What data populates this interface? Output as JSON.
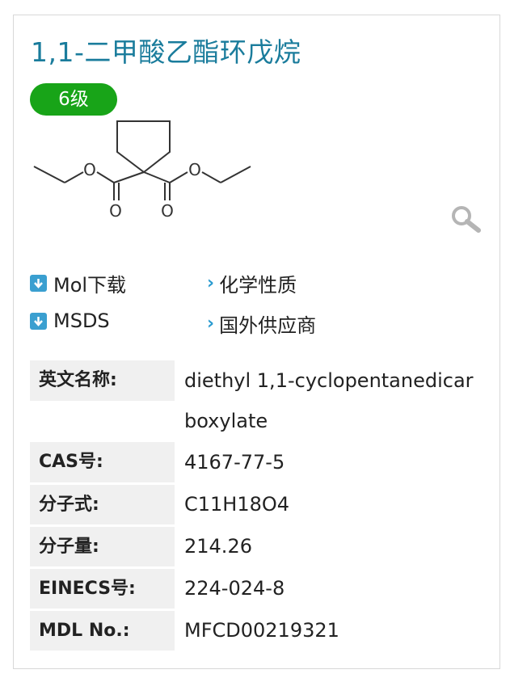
{
  "title": "1,1-二甲酸乙酯环戊烷",
  "badge": "6级",
  "structure": {
    "atom_labels": [
      "O",
      "O",
      "O",
      "O"
    ],
    "zoom_icon": "magnifier-icon"
  },
  "links": {
    "mol_download": "Mol下载",
    "msds": "MSDS",
    "chemical_properties": "化学性质",
    "foreign_suppliers": "国外供应商"
  },
  "properties": [
    {
      "label": "英文名称:",
      "value": "diethyl 1,1-cyclopentanedicarboxylate"
    },
    {
      "label": "CAS号:",
      "value": "4167-77-5"
    },
    {
      "label": "分子式:",
      "value": "C11H18O4"
    },
    {
      "label": "分子量:",
      "value": "214.26"
    },
    {
      "label": "EINECS号:",
      "value": "224-024-8"
    },
    {
      "label": "MDL No.:",
      "value": "MFCD00219321"
    }
  ],
  "colors": {
    "title": "#1a7c9c",
    "badge": "#18a418",
    "icon": "#3a9fd0"
  }
}
